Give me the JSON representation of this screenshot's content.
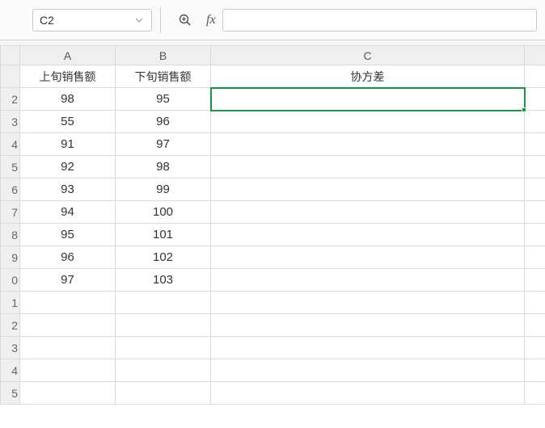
{
  "toolbar": {
    "namebox_value": "C2",
    "fx_label": "fx",
    "formula_value": ""
  },
  "columns": {
    "A": "A",
    "B": "B",
    "C": "C"
  },
  "row_headers": [
    "",
    "2",
    "3",
    "4",
    "5",
    "6",
    "7",
    "8",
    "9",
    "0",
    "1",
    "2",
    "3",
    "4",
    "5"
  ],
  "headers": {
    "A": "上旬销售额",
    "B": "下旬销售额",
    "C": "协方差"
  },
  "rows": [
    {
      "A": "98",
      "B": "95"
    },
    {
      "A": "55",
      "B": "96"
    },
    {
      "A": "91",
      "B": "97"
    },
    {
      "A": "92",
      "B": "98"
    },
    {
      "A": "93",
      "B": "99"
    },
    {
      "A": "94",
      "B": "100"
    },
    {
      "A": "95",
      "B": "101"
    },
    {
      "A": "96",
      "B": "102"
    },
    {
      "A": "97",
      "B": "103"
    }
  ],
  "chart_data": {
    "type": "table",
    "title": "",
    "columns": [
      "上旬销售额",
      "下旬销售额",
      "协方差"
    ],
    "data": [
      [
        98,
        95,
        null
      ],
      [
        55,
        96,
        null
      ],
      [
        91,
        97,
        null
      ],
      [
        92,
        98,
        null
      ],
      [
        93,
        99,
        null
      ],
      [
        94,
        100,
        null
      ],
      [
        95,
        101,
        null
      ],
      [
        96,
        102,
        null
      ],
      [
        97,
        103,
        null
      ]
    ]
  },
  "selection": {
    "cell": "C2"
  }
}
